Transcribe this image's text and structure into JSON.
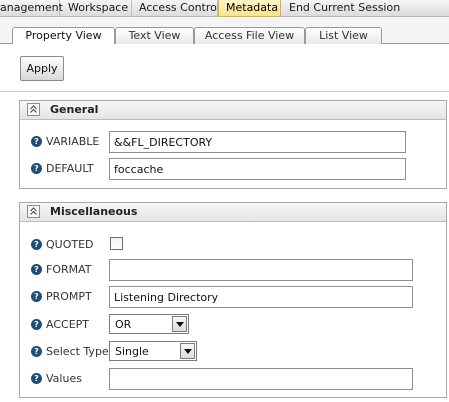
{
  "menu": {
    "items": [
      {
        "label": "anagement"
      },
      {
        "label": "Workspace"
      },
      {
        "label": "Access Control"
      },
      {
        "label": "Metadata"
      },
      {
        "label": "End Current Session"
      }
    ],
    "active": "Metadata"
  },
  "tabs": {
    "items": [
      {
        "label": "Property View"
      },
      {
        "label": "Text View"
      },
      {
        "label": "Access File View"
      },
      {
        "label": "List View"
      }
    ],
    "selected": "Property View"
  },
  "toolbar": {
    "apply_label": "Apply"
  },
  "general": {
    "title": "General",
    "variable": {
      "label": "VARIABLE",
      "value": "&&FL_DIRECTORY"
    },
    "default": {
      "label": "DEFAULT",
      "value": "foccache"
    }
  },
  "misc": {
    "title": "Miscellaneous",
    "quoted": {
      "label": "QUOTED",
      "checked": false
    },
    "format": {
      "label": "FORMAT",
      "value": ""
    },
    "prompt": {
      "label": "PROMPT",
      "value": "Listening Directory"
    },
    "accept": {
      "label": "ACCEPT",
      "value": "OR"
    },
    "select_type": {
      "label": "Select Type",
      "value": "Single"
    },
    "values": {
      "label": "Values",
      "value": ""
    }
  },
  "icons": {
    "help": "?",
    "collapse": "chevron-up-double-icon"
  },
  "colors": {
    "active_tab": "#f7e38a",
    "help_icon": "#1f4d7a"
  }
}
